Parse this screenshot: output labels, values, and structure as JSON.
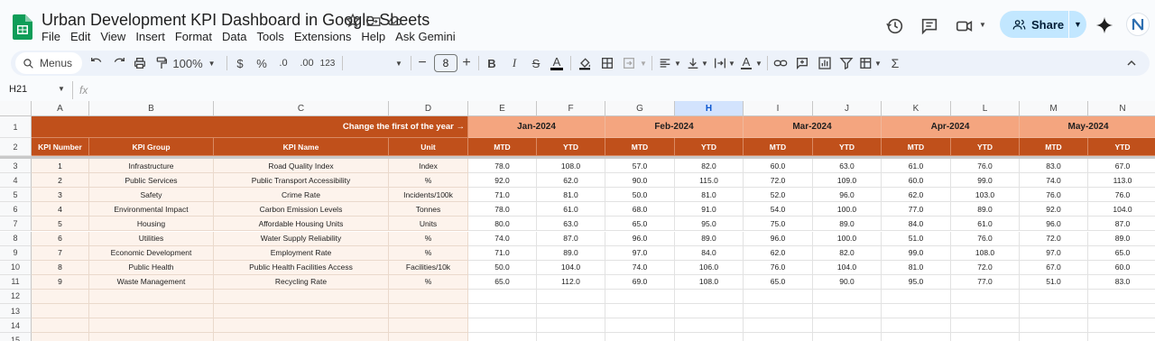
{
  "doc": {
    "title": "Urban Development KPI Dashboard in Google Sheets"
  },
  "menu": [
    "File",
    "Edit",
    "View",
    "Insert",
    "Format",
    "Data",
    "Tools",
    "Extensions",
    "Help",
    "Ask Gemini"
  ],
  "share_label": "Share",
  "toolbar": {
    "menus_label": "Menus",
    "zoom": "100%",
    "currency": "$",
    "percent": "%",
    "dec_less": ".0",
    "dec_more": ".00",
    "number_format": "123",
    "font_size": "8"
  },
  "formula_bar": {
    "cell_ref": "H21",
    "fx": "fx"
  },
  "sheet": {
    "columns": [
      "A",
      "B",
      "C",
      "D",
      "E",
      "F",
      "G",
      "H",
      "I",
      "J",
      "K",
      "L",
      "M",
      "N"
    ],
    "selected_column": "H",
    "row_numbers": [
      "1",
      "2",
      "3",
      "4",
      "5",
      "6",
      "7",
      "8",
      "9",
      "10",
      "11",
      "12",
      "13",
      "14",
      "15"
    ],
    "change_note": "Change the first of the year →",
    "months": [
      "Jan-2024",
      "Feb-2024",
      "Mar-2024",
      "Apr-2024",
      "May-2024"
    ],
    "headers": {
      "kpi_number": "KPI Number",
      "kpi_group": "KPI Group",
      "kpi_name": "KPI Name",
      "unit": "Unit",
      "mtd": "MTD",
      "ytd": "YTD"
    },
    "rows": [
      {
        "num": "1",
        "group": "Infrastructure",
        "name": "Road Quality Index",
        "unit": "Index",
        "values": [
          "78.0",
          "108.0",
          "57.0",
          "82.0",
          "60.0",
          "63.0",
          "61.0",
          "76.0",
          "83.0",
          "67.0"
        ]
      },
      {
        "num": "2",
        "group": "Public Services",
        "name": "Public Transport Accessibility",
        "unit": "%",
        "values": [
          "92.0",
          "62.0",
          "90.0",
          "115.0",
          "72.0",
          "109.0",
          "60.0",
          "99.0",
          "74.0",
          "113.0"
        ]
      },
      {
        "num": "3",
        "group": "Safety",
        "name": "Crime Rate",
        "unit": "Incidents/100k",
        "values": [
          "71.0",
          "81.0",
          "50.0",
          "81.0",
          "52.0",
          "96.0",
          "62.0",
          "103.0",
          "76.0",
          "76.0"
        ]
      },
      {
        "num": "4",
        "group": "Environmental Impact",
        "name": "Carbon Emission Levels",
        "unit": "Tonnes",
        "values": [
          "78.0",
          "61.0",
          "68.0",
          "91.0",
          "54.0",
          "100.0",
          "77.0",
          "89.0",
          "92.0",
          "104.0"
        ]
      },
      {
        "num": "5",
        "group": "Housing",
        "name": "Affordable Housing Units",
        "unit": "Units",
        "values": [
          "80.0",
          "63.0",
          "65.0",
          "95.0",
          "75.0",
          "89.0",
          "84.0",
          "61.0",
          "96.0",
          "87.0"
        ]
      },
      {
        "num": "6",
        "group": "Utilities",
        "name": "Water Supply Reliability",
        "unit": "%",
        "values": [
          "74.0",
          "87.0",
          "96.0",
          "89.0",
          "96.0",
          "100.0",
          "51.0",
          "76.0",
          "72.0",
          "89.0"
        ]
      },
      {
        "num": "7",
        "group": "Economic Development",
        "name": "Employment Rate",
        "unit": "%",
        "values": [
          "71.0",
          "89.0",
          "97.0",
          "84.0",
          "62.0",
          "82.0",
          "99.0",
          "108.0",
          "97.0",
          "65.0"
        ]
      },
      {
        "num": "8",
        "group": "Public Health",
        "name": "Public Health Facilities Access",
        "unit": "Facilities/10k",
        "values": [
          "50.0",
          "104.0",
          "74.0",
          "106.0",
          "76.0",
          "104.0",
          "81.0",
          "72.0",
          "67.0",
          "60.0"
        ]
      },
      {
        "num": "9",
        "group": "Waste Management",
        "name": "Recycling Rate",
        "unit": "%",
        "values": [
          "65.0",
          "112.0",
          "69.0",
          "108.0",
          "65.0",
          "90.0",
          "95.0",
          "77.0",
          "51.0",
          "83.0"
        ]
      }
    ]
  }
}
